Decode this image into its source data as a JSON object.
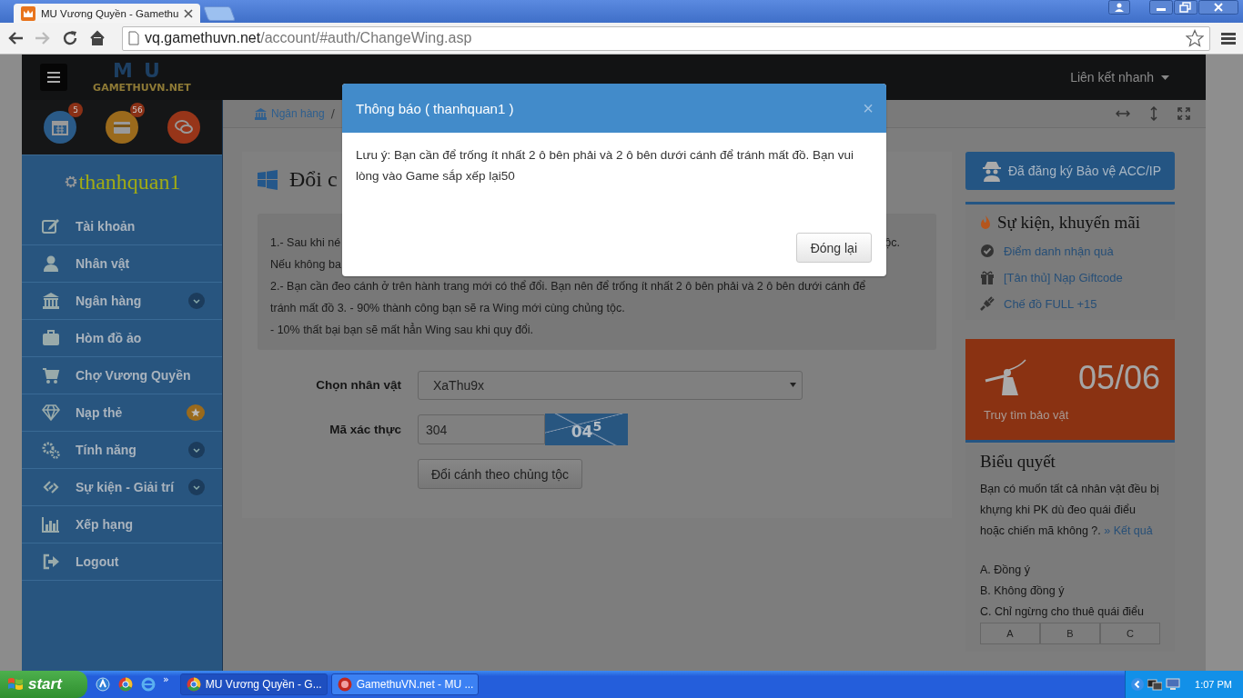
{
  "browser": {
    "tab_title": "MU Vương Quyền - Gamethu",
    "url_host": "vq.gamethuvn.net",
    "url_path": "/account/#auth/ChangeWing.asp"
  },
  "header": {
    "logo_mark": "MU",
    "logo_text": "GAMETHUVN.NET",
    "quick_links": "Liên kết nhanh"
  },
  "sidebar": {
    "shortcuts": [
      {
        "badge": "5",
        "color": "#2a5a87"
      },
      {
        "badge": "56",
        "color": "#9a6a1c"
      },
      {
        "color": "#973519"
      }
    ],
    "username": "thanhquan1",
    "items": [
      {
        "label": "Tài khoản",
        "kind": "plain"
      },
      {
        "label": "Nhân vật",
        "kind": "plain"
      },
      {
        "label": "Ngân hàng",
        "kind": "dropdown"
      },
      {
        "label": "Hòm đồ ảo",
        "kind": "plain"
      },
      {
        "label": "Chợ Vương Quyền",
        "kind": "plain"
      },
      {
        "label": "Nạp thẻ",
        "kind": "star"
      },
      {
        "label": "Tính năng",
        "kind": "dropdown"
      },
      {
        "label": "Sự kiện - Giải trí",
        "kind": "dropdown"
      },
      {
        "label": "Xếp hạng",
        "kind": "plain"
      },
      {
        "label": "Logout",
        "kind": "plain"
      }
    ]
  },
  "breadcrumb": {
    "label": "Ngân hàng",
    "separator": "/"
  },
  "content": {
    "title": "Đổi c",
    "notice_lines": [
      {
        "parts": [
          "1.- Sau khi né",
          "ộc."
        ]
      },
      {
        "parts": [
          "Nếu không ba"
        ]
      },
      {
        "parts": [
          "2.- Bạn cần đeo cánh ở trên hành trang mới có thể đổi. Bạn nên để trống ít nhất 2 ô bên phải và 2 ô bên dưới cánh để"
        ]
      },
      {
        "parts": [
          "tránh mất đồ 3. - 90% thành công bạn sẽ ra Wing mới cùng chủng tộc."
        ]
      },
      {
        "parts": [
          "- 10% thất bại bạn sẽ mất hẳn Wing sau khi quy đổi."
        ]
      }
    ],
    "character_label": "Chọn nhân vật",
    "character_value": "XaThu9x",
    "captcha_label": "Mã xác thực",
    "captcha_value": "304",
    "captcha_text": "04$^{5}$",
    "submit": "Đổi cánh theo chủng tộc"
  },
  "right": {
    "protect": "Đã đăng ký Bảo vệ ACC/IP",
    "events_title": "Sự kiện, khuyến mãi",
    "events": [
      "Điểm danh nhận quà",
      "[Tân thủ] Nạp Giftcode",
      "Chế đồ FULL +15"
    ],
    "stat_value": "05/06",
    "stat_label": "Truy tìm bảo vật",
    "poll_title": "Biểu quyết",
    "poll_question": "Bạn có muốn tất cả nhân vật đều bị khựng khi PK dù đeo quái điểu hoặc chiến mã không ?.",
    "poll_link": "» Kết quả",
    "poll_options": [
      "A. Đồng ý",
      "B. Không đồng ý",
      "C. Chỉ ngừng cho thuê quái điểu"
    ],
    "vote_buttons": [
      "A",
      "B",
      "C"
    ]
  },
  "modal": {
    "title": "Thông báo ( thanhquan1 )",
    "close": "×",
    "message": "Lưu ý: Bạn cần để trống ít nhất 2 ô bên phải và 2 ô bên dưới cánh để tránh mất đồ. Bạn vui lòng vào Game sắp xếp lại50",
    "button": "Đóng lại"
  },
  "taskbar": {
    "start": "start",
    "more": "»",
    "tasks": [
      {
        "label": "MU Vương Quyền - G...",
        "selected": true
      },
      {
        "label": "GamethuVN.net - MU ...",
        "selected": false
      }
    ],
    "clock": "1:07 PM"
  }
}
